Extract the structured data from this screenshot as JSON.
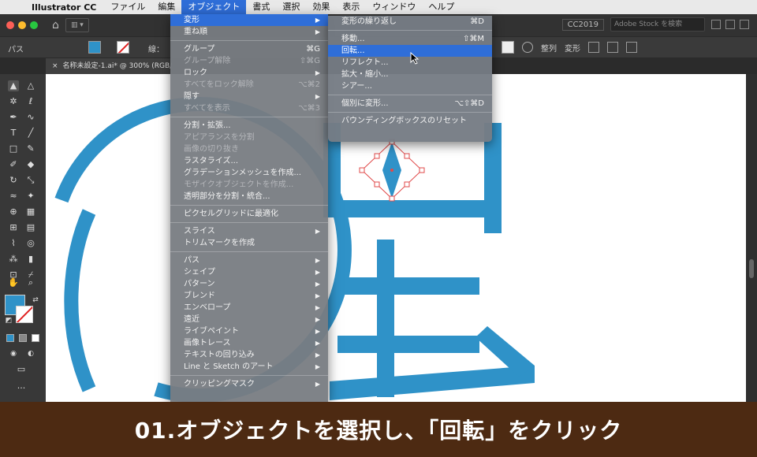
{
  "menubar": {
    "app_name": "Illustrator CC",
    "items": [
      "ファイル",
      "編集",
      "オブジェクト",
      "書式",
      "選択",
      "効果",
      "表示",
      "ウィンドウ",
      "ヘルプ"
    ]
  },
  "appbar": {
    "workspace_label": "CC2019",
    "stock_search_placeholder": "Adobe Stock を検索"
  },
  "controlbar": {
    "path_label": "パス",
    "stroke_label": "線：",
    "fill_color": "#2f92c8",
    "actions": [
      "整列",
      "変形"
    ]
  },
  "document_tab": {
    "title": "名称未設定-1.ai* @ 300% (RGB/C"
  },
  "object_menu": {
    "items": [
      {
        "label": "変形",
        "shortcut": "",
        "submenu": true,
        "state": "active"
      },
      {
        "label": "重ね順",
        "shortcut": "",
        "submenu": true,
        "state": "normal"
      },
      {
        "sep": true
      },
      {
        "label": "グループ",
        "shortcut": "⌘G",
        "submenu": false,
        "state": "normal"
      },
      {
        "label": "グループ解除",
        "shortcut": "⇧⌘G",
        "submenu": false,
        "state": "disabled"
      },
      {
        "label": "ロック",
        "shortcut": "",
        "submenu": true,
        "state": "normal"
      },
      {
        "label": "すべてをロック解除",
        "shortcut": "⌥⌘2",
        "submenu": false,
        "state": "disabled"
      },
      {
        "label": "隠す",
        "shortcut": "",
        "submenu": true,
        "state": "normal"
      },
      {
        "label": "すべてを表示",
        "shortcut": "⌥⌘3",
        "submenu": false,
        "state": "disabled"
      },
      {
        "sep": true
      },
      {
        "label": "分割・拡張...",
        "shortcut": "",
        "submenu": false,
        "state": "normal"
      },
      {
        "label": "アピアランスを分割",
        "shortcut": "",
        "submenu": false,
        "state": "disabled"
      },
      {
        "label": "画像の切り抜き",
        "shortcut": "",
        "submenu": false,
        "state": "disabled"
      },
      {
        "label": "ラスタライズ...",
        "shortcut": "",
        "submenu": false,
        "state": "normal"
      },
      {
        "label": "グラデーションメッシュを作成...",
        "shortcut": "",
        "submenu": false,
        "state": "normal"
      },
      {
        "label": "モザイクオブジェクトを作成...",
        "shortcut": "",
        "submenu": false,
        "state": "disabled"
      },
      {
        "label": "透明部分を分割・統合...",
        "shortcut": "",
        "submenu": false,
        "state": "normal"
      },
      {
        "sep": true
      },
      {
        "label": "ピクセルグリッドに最適化",
        "shortcut": "",
        "submenu": false,
        "state": "normal"
      },
      {
        "sep": true
      },
      {
        "label": "スライス",
        "shortcut": "",
        "submenu": true,
        "state": "normal"
      },
      {
        "label": "トリムマークを作成",
        "shortcut": "",
        "submenu": false,
        "state": "normal"
      },
      {
        "sep": true
      },
      {
        "label": "パス",
        "shortcut": "",
        "submenu": true,
        "state": "normal"
      },
      {
        "label": "シェイプ",
        "shortcut": "",
        "submenu": true,
        "state": "normal"
      },
      {
        "label": "パターン",
        "shortcut": "",
        "submenu": true,
        "state": "normal"
      },
      {
        "label": "ブレンド",
        "shortcut": "",
        "submenu": true,
        "state": "normal"
      },
      {
        "label": "エンベロープ",
        "shortcut": "",
        "submenu": true,
        "state": "normal"
      },
      {
        "label": "遠近",
        "shortcut": "",
        "submenu": true,
        "state": "normal"
      },
      {
        "label": "ライブペイント",
        "shortcut": "",
        "submenu": true,
        "state": "normal"
      },
      {
        "label": "画像トレース",
        "shortcut": "",
        "submenu": true,
        "state": "normal"
      },
      {
        "label": "テキストの回り込み",
        "shortcut": "",
        "submenu": true,
        "state": "normal"
      },
      {
        "label": "Line と Sketch のアート",
        "shortcut": "",
        "submenu": true,
        "state": "normal"
      },
      {
        "sep": true
      },
      {
        "label": "クリッピングマスク",
        "shortcut": "",
        "submenu": true,
        "state": "normal"
      }
    ]
  },
  "transform_menu": {
    "items": [
      {
        "label": "変形の繰り返し",
        "shortcut": "⌘D",
        "state": "normal"
      },
      {
        "sep": true
      },
      {
        "label": "移動...",
        "shortcut": "⇧⌘M",
        "state": "normal"
      },
      {
        "label": "回転...",
        "shortcut": "",
        "state": "active"
      },
      {
        "label": "リフレクト...",
        "shortcut": "",
        "state": "normal"
      },
      {
        "label": "拡大・縮小...",
        "shortcut": "",
        "state": "normal"
      },
      {
        "label": "シアー...",
        "shortcut": "",
        "state": "normal"
      },
      {
        "sep": true
      },
      {
        "label": "個別に変形...",
        "shortcut": "⌥⇧⌘D",
        "state": "normal"
      },
      {
        "sep": true
      },
      {
        "label": "バウンディングボックスのリセット",
        "shortcut": "",
        "state": "normal"
      }
    ]
  },
  "caption": {
    "text": "01.オブジェクトを選択し、「回転」をクリック"
  },
  "colors": {
    "accent": "#2f6ed8",
    "artwork_blue": "#2f92c8",
    "caption_bg": "#4d2a12",
    "selection_red": "#e04a4a"
  }
}
